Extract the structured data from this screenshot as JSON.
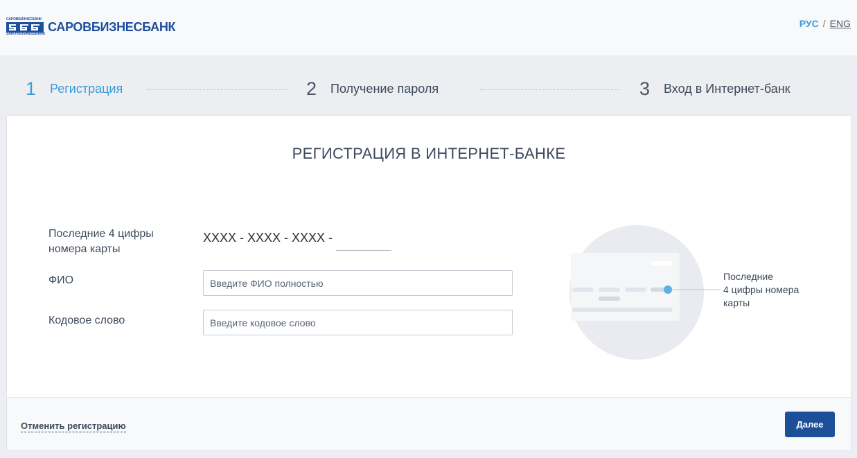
{
  "header": {
    "bank_name": "САРОВБИЗНЕСБАНК",
    "logo_small_ru": "САРОВБИЗНЕСБАНК",
    "logo_small_en": "SAROVBUSINESSBANK",
    "lang_ru": "РУС",
    "lang_separator": "/",
    "lang_en": "ENG"
  },
  "steps": [
    {
      "num": "1",
      "label": "Регистрация",
      "active": true
    },
    {
      "num": "2",
      "label": "Получение пароля",
      "active": false
    },
    {
      "num": "3",
      "label": "Вход в Интернет-банк",
      "active": false
    }
  ],
  "form": {
    "title": "РЕГИСТРАЦИЯ В ИНТЕРНЕТ-БАНКЕ",
    "card_label_line1": "Последние 4 цифры",
    "card_label_line2": "номера карты",
    "card_mask": "XXXX - XXXX - XXXX -",
    "card_last4_value": "",
    "fio_label": "ФИО",
    "fio_placeholder": "Введите ФИО полностью",
    "fio_value": "",
    "code_label": "Кодовое слово",
    "code_placeholder": "Введите кодовое слово",
    "code_value": ""
  },
  "illustration": {
    "caption_line1": "Последние",
    "caption_line2": "4 цифры номера",
    "caption_line3": "карты"
  },
  "footer": {
    "cancel_label": "Отменить регистрацию",
    "next_label": "Далее"
  },
  "colors": {
    "brand": "#1d4f9c",
    "accent": "#3a9bd5",
    "button": "#1b4f97"
  }
}
